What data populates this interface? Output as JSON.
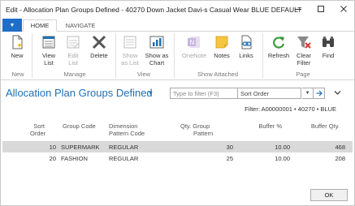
{
  "window": {
    "title": "Edit - Allocation Plan Groups Defined - 40270 Down Jacket Davi-s Casual Wear BLUE DEFAULT",
    "controls": [
      "minimize",
      "maximize",
      "close"
    ]
  },
  "ribbon": {
    "tabs": [
      {
        "label": "HOME",
        "active": true
      },
      {
        "label": "NAVIGATE",
        "active": false
      }
    ],
    "buttons": {
      "new": "New",
      "view_list_1": "View",
      "view_list_2": "List",
      "edit_list_1": "Edit",
      "edit_list_2": "List",
      "delete": "Delete",
      "show_as_list_1": "Show",
      "show_as_list_2": "as List",
      "show_as_chart_1": "Show as",
      "show_as_chart_2": "Chart",
      "onenote": "OneNote",
      "notes": "Notes",
      "links": "Links",
      "refresh": "Refresh",
      "clear_filter_1": "Clear",
      "clear_filter_2": "Filter",
      "find": "Find"
    },
    "groups": {
      "new": "New",
      "manage": "Manage",
      "view": "View",
      "show_attached": "Show Attached",
      "page": "Page"
    }
  },
  "page": {
    "title": "Allocation Plan Groups Defined",
    "filter_placeholder": "Type to filter (F3)",
    "sort_value": "Sort Order",
    "filter_text": "Filter: A00000001 • 40270 • BLUE"
  },
  "grid": {
    "headers": {
      "sort_order_1": "Sort",
      "sort_order_2": "Order",
      "group_code": "Group Code",
      "dim_pattern_1": "Dimension",
      "dim_pattern_2": "Pattern Code",
      "qty_group_1": "Qty. Group",
      "qty_group_2": "Pattern",
      "buffer_pct": "Buffer %",
      "buffer_qty": "Buffer Qty."
    },
    "rows": [
      {
        "sort_order": "10",
        "group_code": "SUPERMARK",
        "dim_pattern": "REGULAR",
        "qty_group": "30",
        "buffer_pct": "10.00",
        "buffer_qty": "468",
        "selected": true
      },
      {
        "sort_order": "20",
        "group_code": "FASHION",
        "dim_pattern": "REGULAR",
        "qty_group": "25",
        "buffer_pct": "10.00",
        "buffer_qty": "208",
        "selected": false
      }
    ]
  },
  "footer": {
    "ok": "OK"
  },
  "colors": {
    "accent": "#1f6fb5",
    "app_button": "#1e6ec8",
    "selected_row": "#d9d9d9"
  }
}
